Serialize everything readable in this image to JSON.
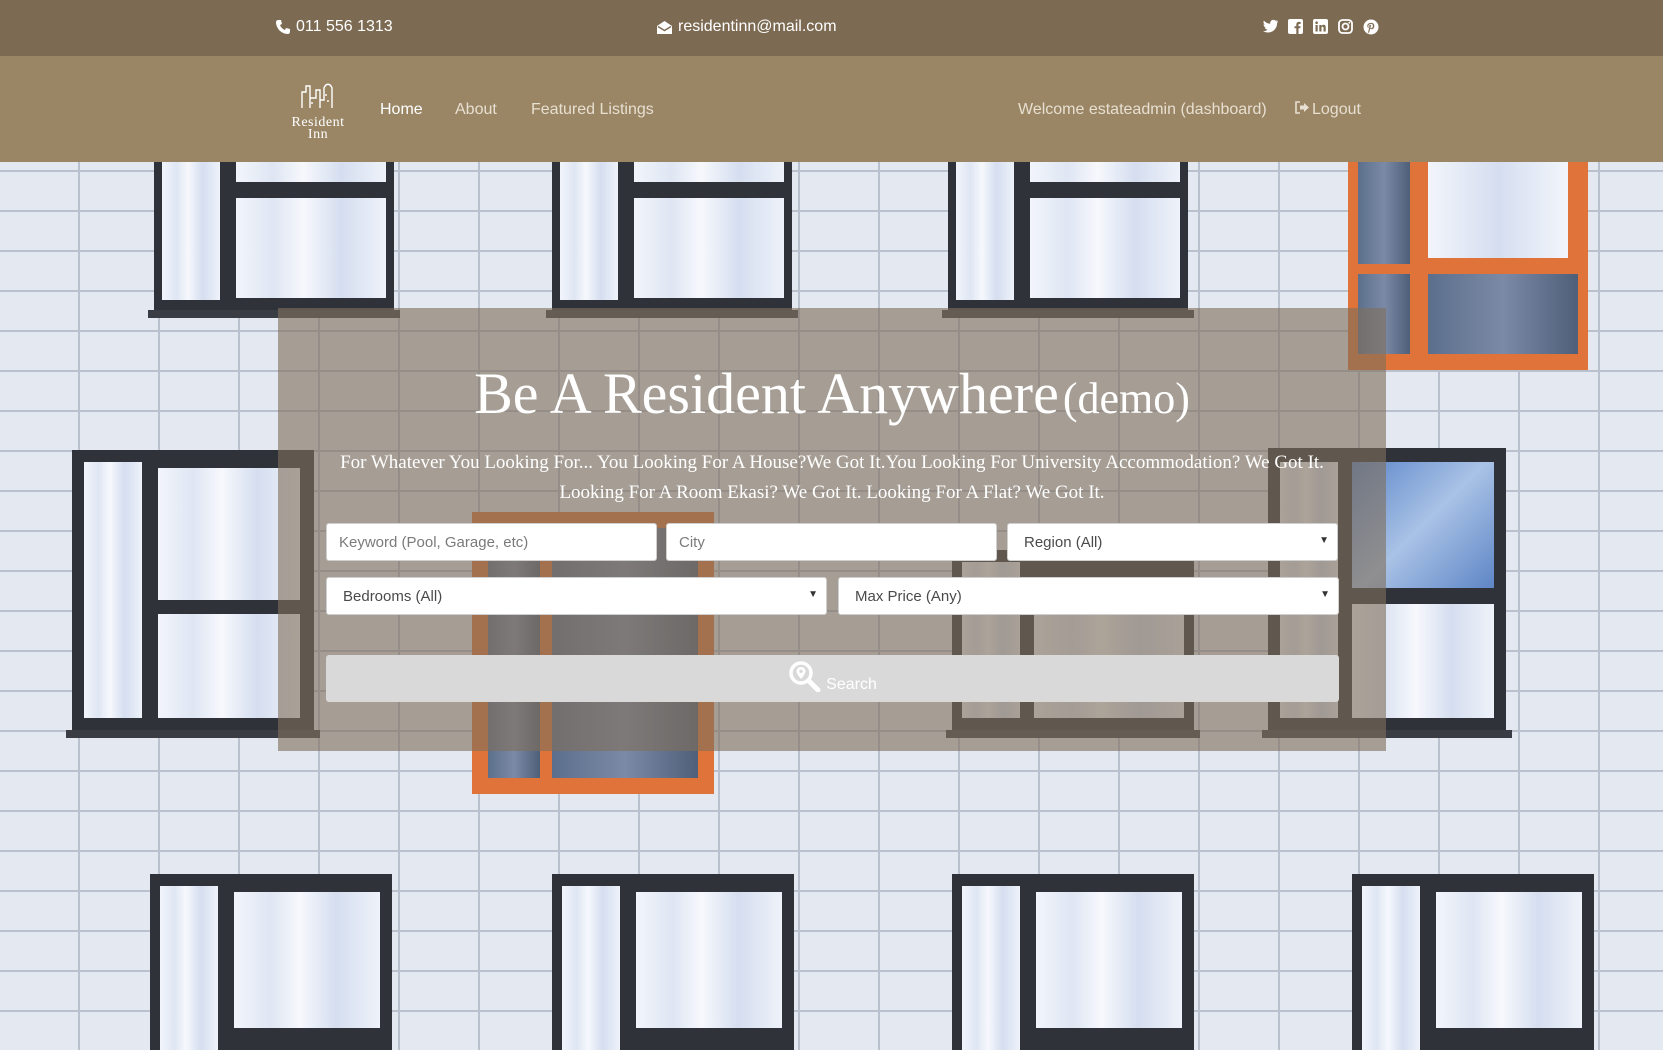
{
  "topbar": {
    "phone": "011 556 1313",
    "email": "residentinn@mail.com",
    "social": [
      "twitter-icon",
      "facebook-icon",
      "linkedin-icon",
      "instagram-icon",
      "pinterest-icon"
    ],
    "background": "#7c6a52"
  },
  "navbar": {
    "logo_line1": "Resident",
    "logo_line2": "Inn",
    "home": "Home",
    "about": "About",
    "featured": "Featured Listings",
    "welcome": "Welcome estateadmin (dashboard)",
    "logout": "Logout",
    "background": "#9a8665"
  },
  "hero": {
    "title": "Be A Resident Anywhere",
    "title_suffix": "(demo)",
    "subtitle": "For Whatever You Looking For... You Looking For A House?We Got It.You Looking For University Accommodation? We Got It. Looking For A Room Ekasi? We Got It. Looking For A Flat? We Got It."
  },
  "search": {
    "keyword_placeholder": "Keyword (Pool, Garage, etc)",
    "city_placeholder": "City",
    "region_selected": "Region (All)",
    "bedrooms_selected": "Bedrooms (All)",
    "maxprice_selected": "Max Price (Any)",
    "button_label": "Search",
    "button_color": "#d9d9d9"
  }
}
